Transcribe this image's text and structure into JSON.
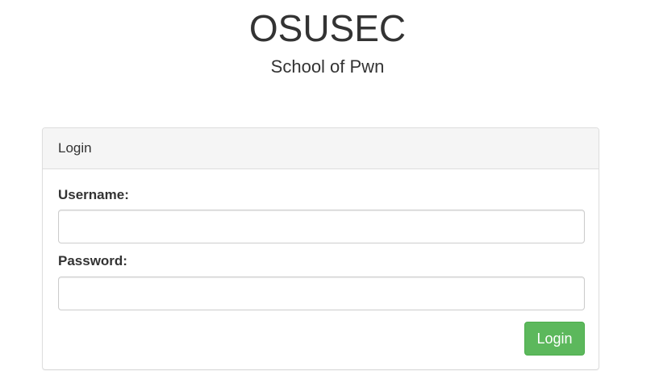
{
  "header": {
    "title": "OSUSEC",
    "subtitle": "School of Pwn"
  },
  "login_panel": {
    "heading": "Login",
    "username": {
      "label": "Username:",
      "value": "",
      "placeholder": ""
    },
    "password": {
      "label": "Password:",
      "value": "",
      "placeholder": ""
    },
    "submit_label": "Login"
  },
  "colors": {
    "button_background": "#5cb85c",
    "panel_heading_background": "#f5f5f5",
    "text": "#333333"
  }
}
